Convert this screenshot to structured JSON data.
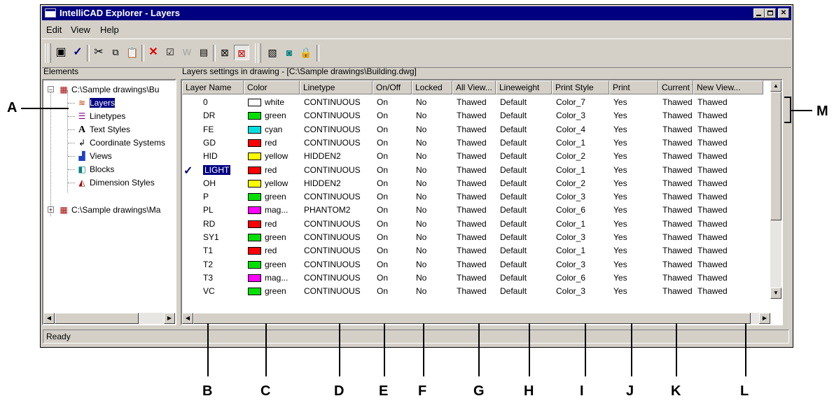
{
  "window": {
    "title": "IntelliCAD Explorer - Layers"
  },
  "menu": [
    "Edit",
    "View",
    "Help"
  ],
  "toolbar_icons": [
    "new-item-icon",
    "set-current-icon",
    "cut-icon",
    "copy-icon",
    "paste-icon",
    "delete-icon",
    "properties-icon",
    "purge-icon",
    "regenerate-icon",
    "select-all-icon",
    "show-all-icon",
    "view-layers-icon",
    "view-tree-icon",
    "lock-icon"
  ],
  "elements_panel": {
    "label": "Elements",
    "tree": [
      {
        "label": "C:\\Sample drawings\\Bu",
        "level": 0,
        "expander": "−",
        "icon": "drawing-file-icon"
      },
      {
        "label": "Layers",
        "level": 1,
        "icon": "layers-icon",
        "selected": true
      },
      {
        "label": "Linetypes",
        "level": 1,
        "icon": "linetypes-icon"
      },
      {
        "label": "Text Styles",
        "level": 1,
        "icon": "text-styles-icon"
      },
      {
        "label": "Coordinate Systems",
        "level": 1,
        "icon": "coordinate-systems-icon"
      },
      {
        "label": "Views",
        "level": 1,
        "icon": "views-icon"
      },
      {
        "label": "Blocks",
        "level": 1,
        "icon": "blocks-icon"
      },
      {
        "label": "Dimension Styles",
        "level": 1,
        "icon": "dimension-styles-icon"
      },
      {
        "label": "C:\\Sample drawings\\Ma",
        "level": 0,
        "expander": "+",
        "icon": "drawing-file-icon"
      }
    ]
  },
  "layers_panel": {
    "label": "Layers settings in drawing - [C:\\Sample drawings\\Building.dwg]",
    "columns": [
      "Layer Name",
      "Color",
      "Linetype",
      "On/Off",
      "Locked",
      "All View...",
      "Lineweight",
      "Print Style",
      "Print",
      "Current View...",
      "New View..."
    ],
    "rows": [
      {
        "name": "0",
        "color": "white",
        "swatch": "#ffffff",
        "linetype": "CONTINUOUS",
        "on": "On",
        "locked": "No",
        "all": "Thawed",
        "lw": "Default",
        "ps": "Color_7",
        "print": "Yes",
        "cur": "Thawed",
        "new": "Thawed"
      },
      {
        "name": "DR",
        "color": "green",
        "swatch": "#00e000",
        "linetype": "CONTINUOUS",
        "on": "On",
        "locked": "No",
        "all": "Thawed",
        "lw": "Default",
        "ps": "Color_3",
        "print": "Yes",
        "cur": "Thawed",
        "new": "Thawed"
      },
      {
        "name": "FE",
        "color": "cyan",
        "swatch": "#00e0e0",
        "linetype": "CONTINUOUS",
        "on": "On",
        "locked": "No",
        "all": "Thawed",
        "lw": "Default",
        "ps": "Color_4",
        "print": "Yes",
        "cur": "Thawed",
        "new": "Thawed"
      },
      {
        "name": "GD",
        "color": "red",
        "swatch": "#ff0000",
        "linetype": "CONTINUOUS",
        "on": "On",
        "locked": "No",
        "all": "Thawed",
        "lw": "Default",
        "ps": "Color_1",
        "print": "Yes",
        "cur": "Thawed",
        "new": "Thawed"
      },
      {
        "name": "HID",
        "color": "yellow",
        "swatch": "#ffff00",
        "linetype": "HIDDEN2",
        "on": "On",
        "locked": "No",
        "all": "Thawed",
        "lw": "Default",
        "ps": "Color_2",
        "print": "Yes",
        "cur": "Thawed",
        "new": "Thawed"
      },
      {
        "name": "LIGHT",
        "color": "red",
        "swatch": "#ff0000",
        "linetype": "CONTINUOUS",
        "on": "On",
        "locked": "No",
        "all": "Thawed",
        "lw": "Default",
        "ps": "Color_1",
        "print": "Yes",
        "cur": "Thawed",
        "new": "Thawed",
        "current": true
      },
      {
        "name": "OH",
        "color": "yellow",
        "swatch": "#ffff00",
        "linetype": "HIDDEN2",
        "on": "On",
        "locked": "No",
        "all": "Thawed",
        "lw": "Default",
        "ps": "Color_2",
        "print": "Yes",
        "cur": "Thawed",
        "new": "Thawed"
      },
      {
        "name": "P",
        "color": "green",
        "swatch": "#00e000",
        "linetype": "CONTINUOUS",
        "on": "On",
        "locked": "No",
        "all": "Thawed",
        "lw": "Default",
        "ps": "Color_3",
        "print": "Yes",
        "cur": "Thawed",
        "new": "Thawed"
      },
      {
        "name": "PL",
        "color": "mag...",
        "swatch": "#ff00ff",
        "linetype": "PHANTOM2",
        "on": "On",
        "locked": "No",
        "all": "Thawed",
        "lw": "Default",
        "ps": "Color_6",
        "print": "Yes",
        "cur": "Thawed",
        "new": "Thawed"
      },
      {
        "name": "RD",
        "color": "red",
        "swatch": "#ff0000",
        "linetype": "CONTINUOUS",
        "on": "On",
        "locked": "No",
        "all": "Thawed",
        "lw": "Default",
        "ps": "Color_1",
        "print": "Yes",
        "cur": "Thawed",
        "new": "Thawed"
      },
      {
        "name": "SY1",
        "color": "green",
        "swatch": "#00e000",
        "linetype": "CONTINUOUS",
        "on": "On",
        "locked": "No",
        "all": "Thawed",
        "lw": "Default",
        "ps": "Color_3",
        "print": "Yes",
        "cur": "Thawed",
        "new": "Thawed"
      },
      {
        "name": "T1",
        "color": "red",
        "swatch": "#ff0000",
        "linetype": "CONTINUOUS",
        "on": "On",
        "locked": "No",
        "all": "Thawed",
        "lw": "Default",
        "ps": "Color_1",
        "print": "Yes",
        "cur": "Thawed",
        "new": "Thawed"
      },
      {
        "name": "T2",
        "color": "green",
        "swatch": "#00e000",
        "linetype": "CONTINUOUS",
        "on": "On",
        "locked": "No",
        "all": "Thawed",
        "lw": "Default",
        "ps": "Color_3",
        "print": "Yes",
        "cur": "Thawed",
        "new": "Thawed"
      },
      {
        "name": "T3",
        "color": "mag...",
        "swatch": "#ff00ff",
        "linetype": "CONTINUOUS",
        "on": "On",
        "locked": "No",
        "all": "Thawed",
        "lw": "Default",
        "ps": "Color_6",
        "print": "Yes",
        "cur": "Thawed",
        "new": "Thawed"
      },
      {
        "name": "VC",
        "color": "green",
        "swatch": "#00e000",
        "linetype": "CONTINUOUS",
        "on": "On",
        "locked": "No",
        "all": "Thawed",
        "lw": "Default",
        "ps": "Color_3",
        "print": "Yes",
        "cur": "Thawed",
        "new": "Thawed"
      }
    ]
  },
  "status": "Ready",
  "callouts": [
    "A",
    "B",
    "C",
    "D",
    "E",
    "F",
    "G",
    "H",
    "I",
    "J",
    "K",
    "L",
    "M"
  ]
}
